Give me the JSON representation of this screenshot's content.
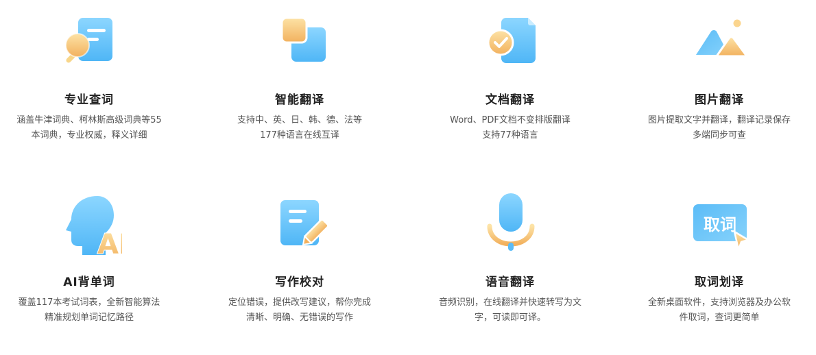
{
  "features": [
    {
      "title": "专业查词",
      "line1": "涵盖牛津词典、柯林斯高级词典等55",
      "line2": "本词典，专业权威，释义详细",
      "icon": "dictionary-search-icon"
    },
    {
      "title": "智能翻译",
      "line1": "支持中、英、日、韩、德、法等",
      "line2": "177种语言在线互译",
      "icon": "smart-translate-icon"
    },
    {
      "title": "文档翻译",
      "line1": "Word、PDF文档不变排版翻译",
      "line2": "支持77种语言",
      "icon": "document-check-icon"
    },
    {
      "title": "图片翻译",
      "line1": "图片提取文字并翻译，翻译记录保存",
      "line2": "多端同步可查",
      "icon": "image-mountain-icon"
    },
    {
      "title": "AI背单词",
      "line1": "覆盖117本考试词表，全新智能算法",
      "line2": "精准规划单词记忆路径",
      "icon": "ai-head-icon",
      "icon_text": "AI"
    },
    {
      "title": "写作校对",
      "line1": "定位错误，提供改写建议，帮你完成",
      "line2": "清晰、明确、无错误的写作",
      "icon": "writing-pencil-icon"
    },
    {
      "title": "语音翻译",
      "line1": "音频识别，在线翻译并快速转写为文",
      "line2": "字，可读即可译。",
      "icon": "microphone-icon"
    },
    {
      "title": "取词划译",
      "line1": "全新桌面软件，支持浏览器及办公软",
      "line2": "件取词，查词更简单",
      "icon": "word-pick-cursor-icon",
      "icon_text": "取词"
    }
  ],
  "colors": {
    "blue_light": "#8fd8ff",
    "blue": "#49b3f5",
    "orange_light": "#fde0a0",
    "orange": "#f3b766"
  }
}
